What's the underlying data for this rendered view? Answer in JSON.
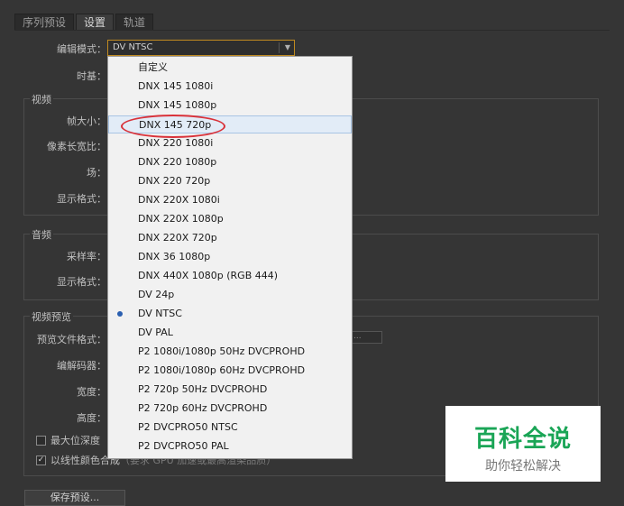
{
  "tabs": [
    {
      "label": "序列预设",
      "active": false
    },
    {
      "label": "设置",
      "active": true
    },
    {
      "label": "轨道",
      "active": false
    }
  ],
  "labels": {
    "edit_mode": "编辑模式：",
    "timebase": "时基：",
    "frame_size": "帧大小：",
    "pixel_aspect": "像素长宽比：",
    "field": "场：",
    "display_format_video": "显示格式：",
    "sample_rate": "采样率：",
    "display_format_audio": "显示格式：",
    "preview_file_format": "预览文件格式：",
    "codec": "编解码器：",
    "width": "宽度：",
    "height": "高度："
  },
  "edit_mode": {
    "value": "DV NTSC"
  },
  "groups": {
    "video": "视频",
    "audio": "音频",
    "video_preview": "视频预览"
  },
  "preview_hint": "...",
  "checkboxes": {
    "max_bit_depth": {
      "label": "最大位深度",
      "checked": false
    },
    "linear_color": {
      "label": "以线性颜色合成",
      "extra": "（要求 GPU 加速或最高渲染品质）",
      "checked": true
    }
  },
  "dropdown": {
    "selected": "DV NTSC",
    "hover": "DNX 145 720p",
    "items": [
      "自定义",
      "DNX 145 1080i",
      "DNX 145 1080p",
      "DNX 145 720p",
      "DNX 220 1080i",
      "DNX 220 1080p",
      "DNX 220 720p",
      "DNX 220X 1080i",
      "DNX 220X 1080p",
      "DNX 220X 720p",
      "DNX 36 1080p",
      "DNX 440X 1080p (RGB 444)",
      "DV 24p",
      "DV NTSC",
      "DV PAL",
      "P2 1080i/1080p 50Hz DVCPROHD",
      "P2 1080i/1080p 60Hz DVCPROHD",
      "P2 720p 50Hz DVCPROHD",
      "P2 720p 60Hz DVCPROHD",
      "P2 DVCPRO50 NTSC",
      "P2 DVCPRO50 PAL"
    ]
  },
  "save_button": "保存预设...",
  "watermark": {
    "main": "百科全说",
    "sub": "助你轻松解决"
  },
  "colors": {
    "accent": "#c08a20",
    "annotation": "#d9323a",
    "watermark_green": "#1aa556"
  }
}
